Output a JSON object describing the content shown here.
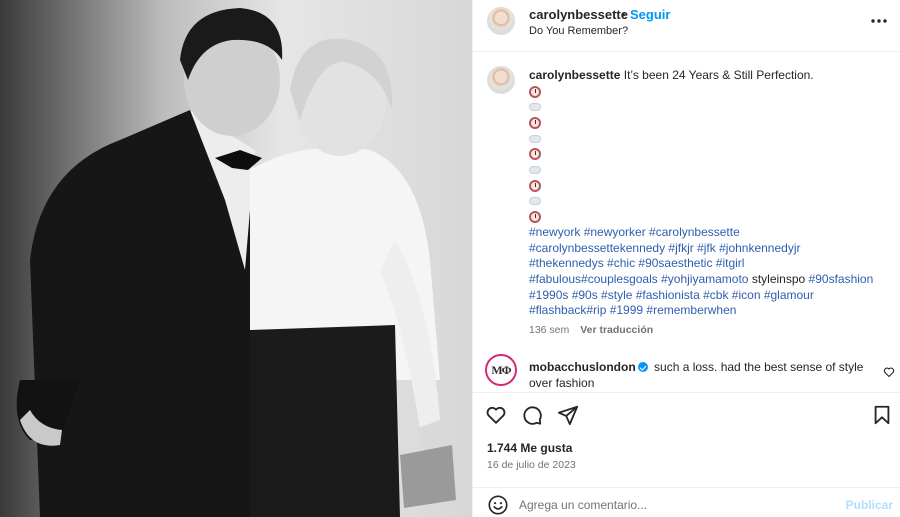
{
  "post": {
    "image_alt": "Black and white photo of a couple in formal wear"
  },
  "header": {
    "username": "carolynbessette",
    "dot": "•",
    "follow_label": "Seguir",
    "subtitle": "Do You Remember?",
    "more_icon": "more-horizontal-icon"
  },
  "caption": {
    "username": "carolynbessette",
    "text": "It’s been 24 Years & Still Perfection.",
    "emoji_rows": [
      "clock",
      "cloud",
      "clock",
      "cloud",
      "clock",
      "cloud",
      "clock",
      "cloud",
      "clock"
    ],
    "tag_lines": [
      "#newyork #newyorker #carolynbessette",
      "#carolynbessettekennedy #jfkjr #jfk #johnkennedyjr",
      "#thekennedys #chic #90saesthetic #itgirl"
    ],
    "tag_line4_a": "#fabulous#couplesgoals #yohjiyamamoto",
    "tag_line4_b": "styleinspo",
    "tag_line4_c": "#90sfashion",
    "tag_lines_end": [
      "#1990s #90s #style #fashionista #cbk #icon #glamour",
      "#flashback#rip #1999 #rememberwhen"
    ],
    "time_ago": "136 sem",
    "translate_label": "Ver traducción"
  },
  "comment": {
    "avatar_text": "MΦ",
    "username": "mobacchuslondon",
    "text": "such a loss. had the best sense of style over fashion"
  },
  "actions": {
    "icons": [
      "heart-icon",
      "comment-icon",
      "share-icon",
      "bookmark-icon"
    ],
    "likes": "1.744 Me gusta",
    "date": "16 de julio de 2023"
  },
  "add_comment": {
    "placeholder": "Agrega un comentario...",
    "publish_label": "Publicar"
  },
  "colors": {
    "link_blue": "#0095f6",
    "hashtag": "#2f5eb0",
    "muted": "#737373"
  }
}
